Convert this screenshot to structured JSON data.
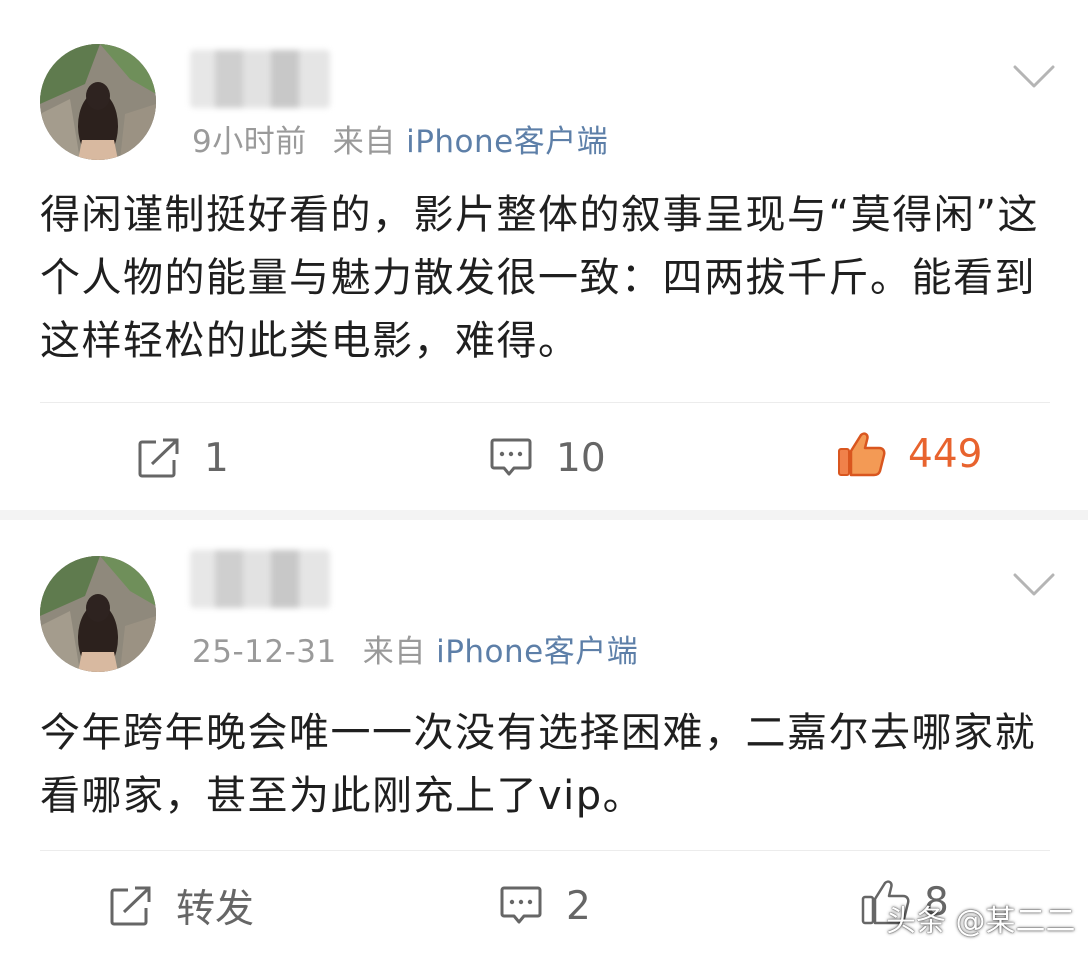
{
  "posts": [
    {
      "time": "9小时前",
      "source_prefix": "来自",
      "source": "iPhone客户端",
      "content": "得闲谨制挺好看的，影片整体的叙事呈现与“莫得闲”这个人物的能量与魅力散发很一致：四两拔千斤。能看到这样轻松的此类电影，难得。",
      "actions": {
        "repost": "1",
        "comment": "10",
        "like": "449"
      }
    },
    {
      "time": "25-12-31",
      "source_prefix": "来自",
      "source": "iPhone客户端",
      "content": "今年跨年晚会唯一一次没有选择困难，二嘉尔去哪家就看哪家，甚至为此刚充上了vip。",
      "actions": {
        "repost": "转发",
        "comment": "2",
        "like": "8"
      }
    }
  ],
  "watermark": "头条 @某二二",
  "icons": {
    "repost": "share-icon",
    "comment": "comment-icon",
    "like": "thumbs-up-icon",
    "menu": "chevron-down-icon"
  },
  "colors": {
    "accent_like": "#e8632e",
    "source_link": "#5d7fa8",
    "meta_gray": "#9a9a9a"
  }
}
